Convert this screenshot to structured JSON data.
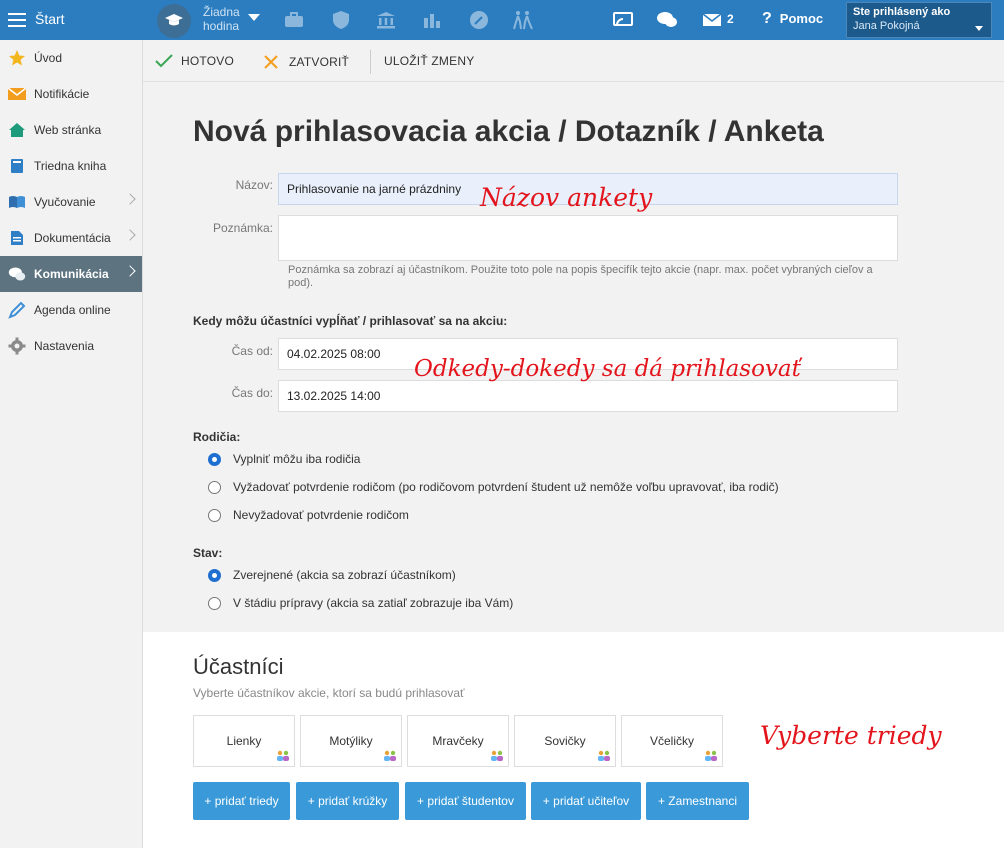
{
  "topbar": {
    "title": "Štart",
    "lesson": "Žiadna hodina",
    "message_count": "2",
    "help_label": "Pomoc",
    "user_heading": "Ste prihlásený ako",
    "user_name": "Jana Pokojná",
    "color": "#2b7dc0"
  },
  "sidebar": {
    "items": [
      {
        "label": "Úvod",
        "icon": "star-icon"
      },
      {
        "label": "Notifikácie",
        "icon": "envelope-icon"
      },
      {
        "label": "Web stránka",
        "icon": "home-icon"
      },
      {
        "label": "Triedna kniha",
        "icon": "book-icon"
      },
      {
        "label": "Vyučovanie",
        "icon": "open-book-icon"
      },
      {
        "label": "Dokumentácia",
        "icon": "document-icon"
      },
      {
        "label": "Komunikácia",
        "icon": "chat-icon"
      },
      {
        "label": "Agenda online",
        "icon": "pen-icon"
      },
      {
        "label": "Nastavenia",
        "icon": "gear-icon"
      }
    ],
    "active": "Komunikácia"
  },
  "toolbar": {
    "done_label": "HOTOVO",
    "close_label": "ZATVORIŤ",
    "save_label": "ULOŽIŤ ZMENY"
  },
  "form": {
    "title": "Nová prihlasovacia akcia / Dotazník / Anketa",
    "name_label": "Názov:",
    "name_value": "Prihlasovanie na jarné prázdniny",
    "note_label": "Poznámka:",
    "note_value": "",
    "note_hint": "Poznámka sa zobrazí aj účastníkom. Použite toto pole na popis špecifík tejto akcie (napr. max. počet vybraných cieľov a pod).",
    "when_heading": "Kedy môžu účastníci vypĺňať / prihlasovať sa na akciu:",
    "from_label": "Čas od:",
    "from_value": "04.02.2025 08:00",
    "to_label": "Čas do:",
    "to_value": "13.02.2025 14:00",
    "parents_heading": "Rodičia:",
    "parents_options": [
      "Vyplniť môžu iba rodičia",
      "Vyžadovať potvrdenie rodičom (po rodičovom potvrdení študent už nemôže voľbu upravovať, iba rodič)",
      "Nevyžadovať potvrdenie rodičom"
    ],
    "parents_selected": 0,
    "status_heading": "Stav:",
    "status_options": [
      "Zverejnené (akcia sa zobrazí účastníkom)",
      "V štádiu prípravy (akcia sa zatiaľ zobrazuje iba Vám)"
    ],
    "status_selected": 0
  },
  "participants": {
    "heading": "Účastníci",
    "subtitle": "Vyberte účastníkov akcie, ktorí sa budú prihlasovať",
    "classes": [
      "Lienky",
      "Motýliky",
      "Mravčeky",
      "Sovičky",
      "Včeličky"
    ],
    "buttons": [
      "+ pridať triedy",
      "+ pridať krúžky",
      "+ pridať študentov",
      "+ pridať učiteľov",
      "+ Zamestnanci"
    ]
  },
  "annotations": {
    "name": "Názov ankety",
    "dates": "Odkedy-dokedy sa dá prihlasovať",
    "classes": "Vyberte triedy",
    "color": "#e3141b"
  }
}
